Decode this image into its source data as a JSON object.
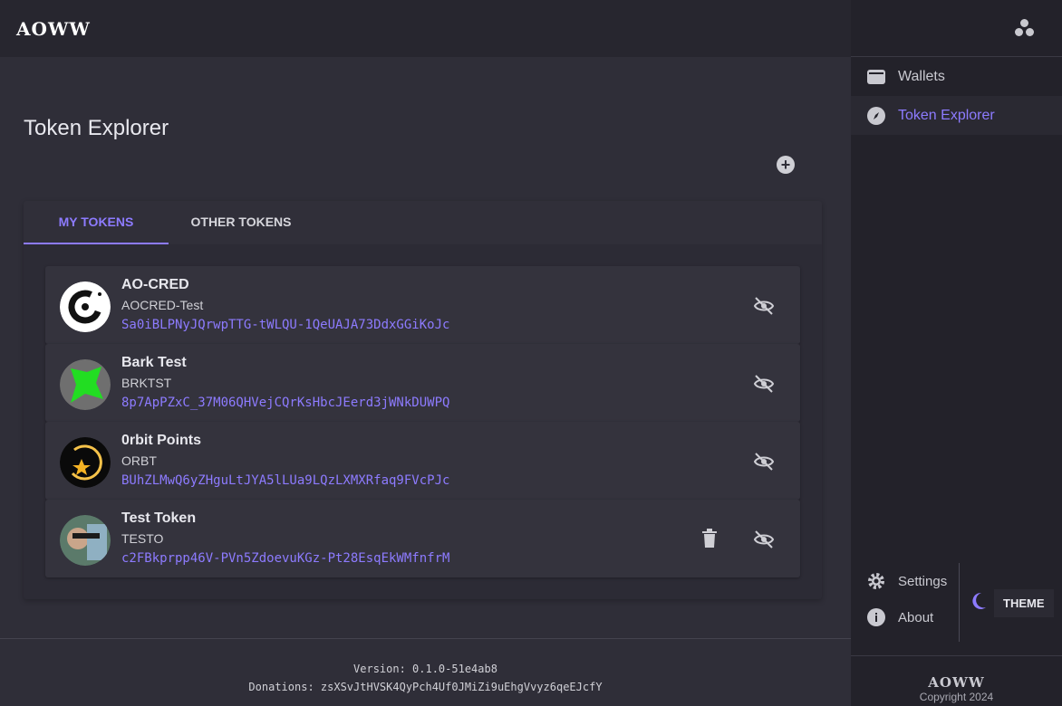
{
  "app": {
    "logo_text": "AOWW"
  },
  "sidebar": {
    "items": [
      {
        "label": "Wallets",
        "icon": "wallet-icon",
        "active": false
      },
      {
        "label": "Token Explorer",
        "icon": "compass-icon",
        "active": true
      }
    ],
    "settings_label": "Settings",
    "about_label": "About",
    "theme_label": "THEME",
    "footer_logo": "AOWW",
    "copyright": "Copyright 2024"
  },
  "main": {
    "title": "Token Explorer",
    "tabs": [
      {
        "label": "MY TOKENS",
        "active": true
      },
      {
        "label": "OTHER TOKENS",
        "active": false
      }
    ],
    "tokens": [
      {
        "name": "AO-CRED",
        "ticker": "AOCRED-Test",
        "id": "Sa0iBLPNyJQrwpTTG-tWLQU-1QeUAJA73DdxGGiKoJc",
        "logo": "ao-cred-logo",
        "deletable": false
      },
      {
        "name": "Bark Test",
        "ticker": "BRKTST",
        "id": "8p7ApPZxC_37M06QHVejCQrKsHbcJEerd3jWNkDUWPQ",
        "logo": "bark-logo",
        "deletable": false
      },
      {
        "name": "0rbit Points",
        "ticker": "ORBT",
        "id": "BUhZLMwQ6yZHguLtJYA5lLUa9LQzLXMXRfaq9FVcPJc",
        "logo": "orbit-logo",
        "deletable": false
      },
      {
        "name": "Test Token",
        "ticker": "TESTO",
        "id": "c2FBkprpp46V-PVn5ZdoevuKGz-Pt28EsqEkWMfnfrM",
        "logo": "test-token-logo",
        "deletable": true
      }
    ]
  },
  "footer": {
    "version": "Version: 0.1.0-51e4ab8",
    "donations": "Donations: zsXSvJtHVSK4QyPch4Uf0JMiZi9uEhgVvyz6qeEJcfY"
  },
  "colors": {
    "accent": "#8d7bff",
    "background": "#2f2e38",
    "sidebar": "#23222a"
  }
}
